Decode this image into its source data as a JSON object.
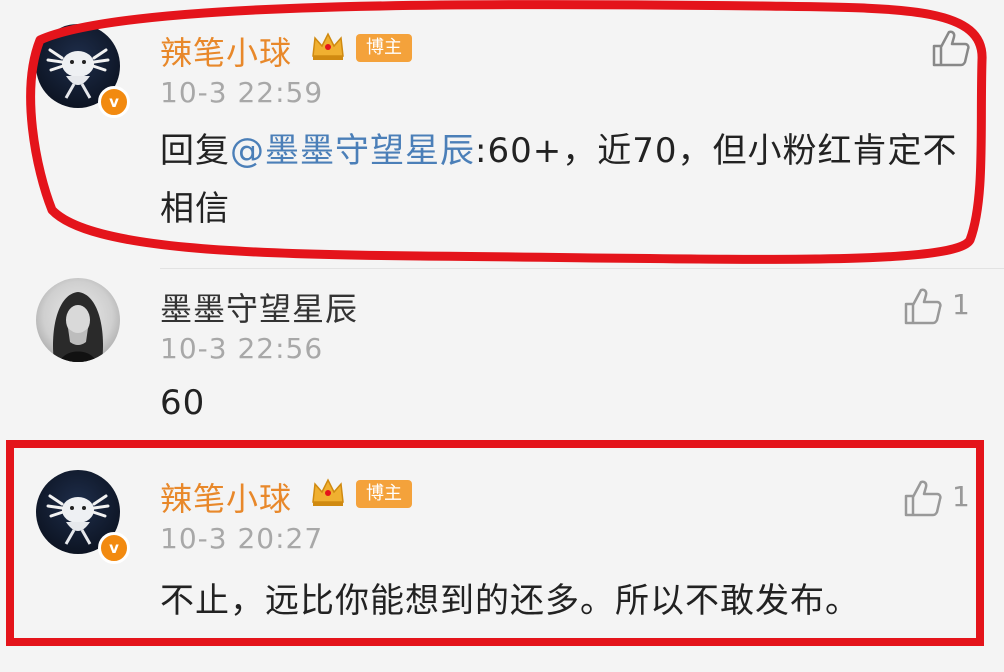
{
  "comments": [
    {
      "name": "辣笔小球",
      "badge": "博主",
      "time": "10-3 22:59",
      "reply_prefix": "回复",
      "mention": "@墨墨守望星辰",
      "text": ":60+，近70，但小粉红肯定不相信",
      "like_count": ""
    },
    {
      "name": "墨墨守望星辰",
      "time": "10-3 22:56",
      "text": "60",
      "like_count": "1"
    },
    {
      "name": "辣笔小球",
      "badge": "博主",
      "time": "10-3 20:27",
      "text": "不止，远比你能想到的还多。所以不敢发布。",
      "like_count": "1"
    }
  ],
  "verified_mark": "v",
  "icons": {
    "like": "thumbs-up-icon",
    "crown": "crown-icon",
    "verified": "verified-badge-icon"
  },
  "colors": {
    "author_name": "#e8882a",
    "mention": "#4b7fb8",
    "timestamp": "#a8a8a8",
    "badge": "#f4a23b",
    "highlight": "#e4141b"
  }
}
